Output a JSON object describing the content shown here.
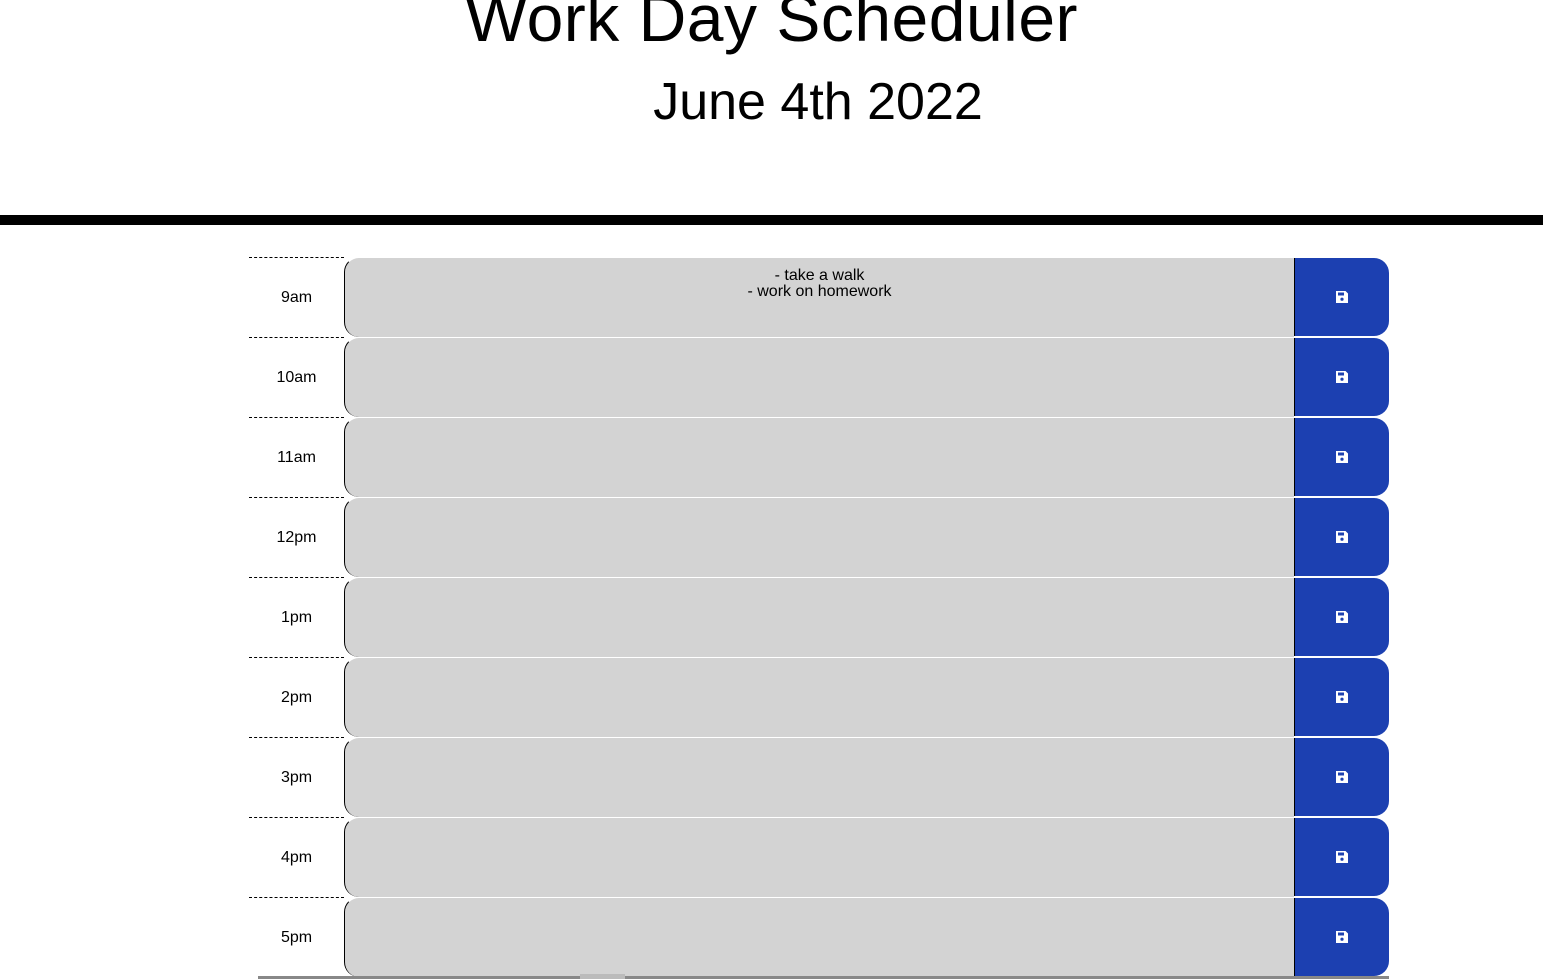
{
  "header": {
    "title": "Work Day Scheduler",
    "date": "June 4th 2022"
  },
  "colors": {
    "slot_background": "#d3d3d3",
    "save_button": "#1c40b1",
    "divider": "#000000"
  },
  "planner": {
    "rows": [
      {
        "hour": "9am",
        "text": "- take a walk\n- work on homework",
        "save_icon": "floppy-disk-icon"
      },
      {
        "hour": "10am",
        "text": "",
        "save_icon": "floppy-disk-icon"
      },
      {
        "hour": "11am",
        "text": "",
        "save_icon": "floppy-disk-icon"
      },
      {
        "hour": "12pm",
        "text": "",
        "save_icon": "floppy-disk-icon"
      },
      {
        "hour": "1pm",
        "text": "",
        "save_icon": "floppy-disk-icon"
      },
      {
        "hour": "2pm",
        "text": "",
        "save_icon": "floppy-disk-icon"
      },
      {
        "hour": "3pm",
        "text": "",
        "save_icon": "floppy-disk-icon"
      },
      {
        "hour": "4pm",
        "text": "",
        "save_icon": "floppy-disk-icon"
      },
      {
        "hour": "5pm",
        "text": "",
        "save_icon": "floppy-disk-icon"
      }
    ]
  }
}
